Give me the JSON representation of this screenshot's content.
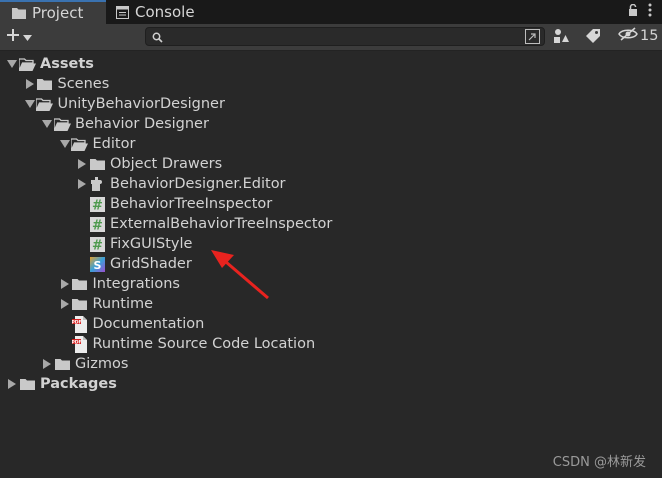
{
  "tabs": [
    {
      "label": "Project",
      "icon": "folder-icon",
      "active": true
    },
    {
      "label": "Console",
      "icon": "console-icon",
      "active": false
    }
  ],
  "toolbar": {
    "add_label": "+",
    "search_placeholder": "",
    "hidden_count": "15"
  },
  "tree": [
    {
      "label": "Assets",
      "depth": 0,
      "expanded": true,
      "arrow": true,
      "icon": "folder-open-icon",
      "bold": true
    },
    {
      "label": "Scenes",
      "depth": 1,
      "expanded": false,
      "arrow": true,
      "icon": "folder-icon"
    },
    {
      "label": "UnityBehaviorDesigner",
      "depth": 1,
      "expanded": true,
      "arrow": true,
      "icon": "folder-open-icon"
    },
    {
      "label": "Behavior Designer",
      "depth": 2,
      "expanded": true,
      "arrow": true,
      "icon": "folder-open-icon"
    },
    {
      "label": "Editor",
      "depth": 3,
      "expanded": true,
      "arrow": true,
      "icon": "folder-open-icon"
    },
    {
      "label": "Object Drawers",
      "depth": 4,
      "expanded": false,
      "arrow": true,
      "icon": "folder-icon"
    },
    {
      "label": "BehaviorDesigner.Editor",
      "depth": 4,
      "expanded": false,
      "arrow": true,
      "icon": "puzzle-icon"
    },
    {
      "label": "BehaviorTreeInspector",
      "depth": 4,
      "arrow": false,
      "icon": "csharp-script-icon"
    },
    {
      "label": "ExternalBehaviorTreeInspector",
      "depth": 4,
      "arrow": false,
      "icon": "csharp-script-icon"
    },
    {
      "label": "FixGUIStyle",
      "depth": 4,
      "arrow": false,
      "icon": "csharp-script-icon"
    },
    {
      "label": "GridShader",
      "depth": 4,
      "arrow": false,
      "icon": "shader-icon"
    },
    {
      "label": "Integrations",
      "depth": 3,
      "expanded": false,
      "arrow": true,
      "icon": "folder-icon"
    },
    {
      "label": "Runtime",
      "depth": 3,
      "expanded": false,
      "arrow": true,
      "icon": "folder-icon"
    },
    {
      "label": "Documentation",
      "depth": 3,
      "arrow": false,
      "icon": "pdf-icon"
    },
    {
      "label": "Runtime Source Code Location",
      "depth": 3,
      "arrow": false,
      "icon": "pdf-icon"
    },
    {
      "label": "Gizmos",
      "depth": 2,
      "expanded": false,
      "arrow": true,
      "icon": "folder-icon"
    },
    {
      "label": "Packages",
      "depth": 0,
      "expanded": false,
      "arrow": true,
      "icon": "folder-icon",
      "bold": true
    }
  ],
  "watermark": "CSDN @林新发",
  "colors": {
    "background": "#282828",
    "toolbar": "#3c3c3c",
    "tabbar": "#191919",
    "text": "#d2d2d2",
    "csharp_icon": "#5aa35a",
    "annotation_arrow": "#e8231f"
  }
}
